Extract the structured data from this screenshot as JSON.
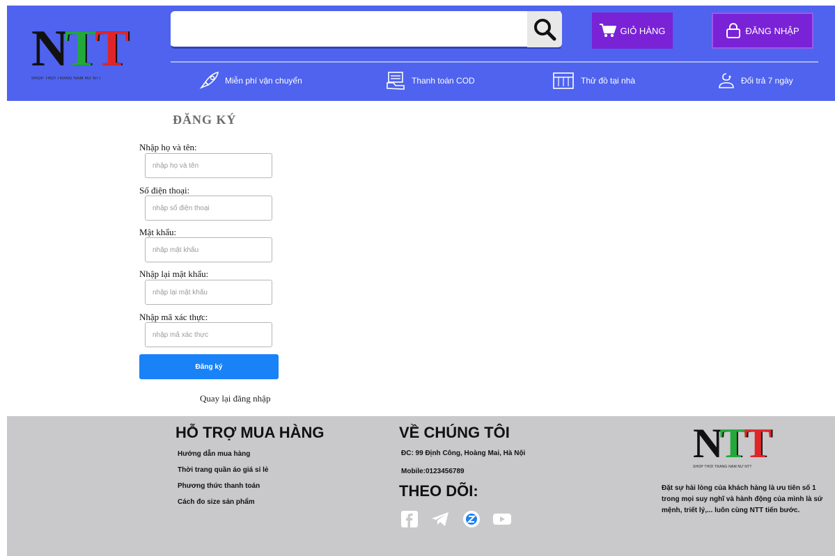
{
  "header": {
    "logo_text": "NTT",
    "logo_tagline": "SHOP THỜI TRANG NAM NỮ NTT",
    "search": {
      "placeholder": "",
      "value": ""
    },
    "cart_label": "GIỎ HÀNG",
    "login_label": "ĐĂNG NHẬP",
    "features": [
      {
        "label": "Miễn phí vận chuyển",
        "icon": "rocket-icon"
      },
      {
        "label": "Thanh toán COD",
        "icon": "cash-icon"
      },
      {
        "label": "Thử đồ tại nhà",
        "icon": "wardrobe-icon"
      },
      {
        "label": "Đổi trả 7 ngày",
        "icon": "return-icon"
      }
    ],
    "colors": {
      "header_bg": "#4f63ee",
      "button_bg": "#7a22d6"
    }
  },
  "form": {
    "title": "ĐĂNG KÝ",
    "fields": [
      {
        "label": "Nhập họ và tên:",
        "placeholder": "nhập họ và tên"
      },
      {
        "label": "Số điện thoại:",
        "placeholder": "nhập số điện thoại"
      },
      {
        "label": "Mật khẩu:",
        "placeholder": "nhập mật khẩu"
      },
      {
        "label": "Nhập lại mật khẩu:",
        "placeholder": "nhập lại mật khẩu"
      },
      {
        "label": "Nhập mã xác thực:",
        "placeholder": "nhập mã xác thực"
      }
    ],
    "submit_label": "Đăng ký",
    "back_link": "Quay lại đăng nhập",
    "colors": {
      "submit_bg": "#1a82f7"
    }
  },
  "footer": {
    "support": {
      "heading": "HỖ TRỢ MUA HÀNG",
      "items": [
        "Hướng dẫn mua hàng",
        "Thời trang quần áo giá sỉ lẻ",
        "Phương thức thanh toán",
        "Cách đo size sản phẩm"
      ]
    },
    "about": {
      "heading": "VỀ CHÚNG TÔI",
      "address": "ĐC: 99 Định Công, Hoàng Mai, Hà Nội",
      "mobile": "Mobile:0123456789",
      "follow_heading": "THEO DÕI:",
      "social": [
        "facebook-icon",
        "telegram-icon",
        "zalo-icon",
        "youtube-icon"
      ]
    },
    "logo_text": "NTT",
    "logo_tagline": "SHOP THỜI TRANG NAM NỮ NTT",
    "description": "Đặt sự hài lòng của khách hàng là ưu tiên số 1 trong mọi suy nghĩ và hành động của mình là sứ mệnh, triết lý,... luôn cùng NTT tiến bước.",
    "colors": {
      "footer_bg": "#c9c9cb"
    }
  }
}
